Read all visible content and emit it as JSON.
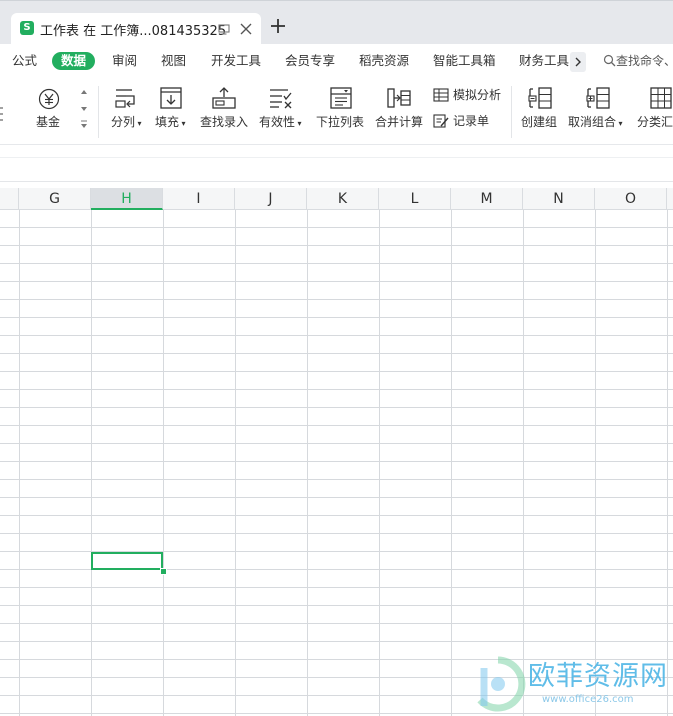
{
  "window": {
    "tab_title": "工作表 在 工作簿...081435325",
    "app_icon_letter": "S"
  },
  "menu": {
    "items": [
      "公式",
      "数据",
      "审阅",
      "视图",
      "开发工具",
      "会员专享",
      "稻壳资源",
      "智能工具箱",
      "财务工具"
    ],
    "active": "数据",
    "search_placeholder": "查找命令、"
  },
  "ribbon": {
    "partial_left_label": "基金",
    "buttons": {
      "split": "分列",
      "fill": "填充",
      "lookup_entry": "查找录入",
      "validity": "有效性",
      "dropdown_list": "下拉列表",
      "consolidate": "合并计算",
      "what_if": "模拟分析",
      "form": "记录单",
      "group": "创建组",
      "ungroup": "取消组合",
      "subtotal": "分类汇"
    }
  },
  "sheet": {
    "columns": [
      "G",
      "H",
      "I",
      "J",
      "K",
      "L",
      "M",
      "N",
      "O"
    ],
    "selected_column": "H",
    "active_cell": "H20"
  },
  "watermark": {
    "text": "欧菲资源网",
    "url": "www.office26.com"
  },
  "colors": {
    "accent": "#22ae5f",
    "watermark": "#4fb6e6"
  }
}
